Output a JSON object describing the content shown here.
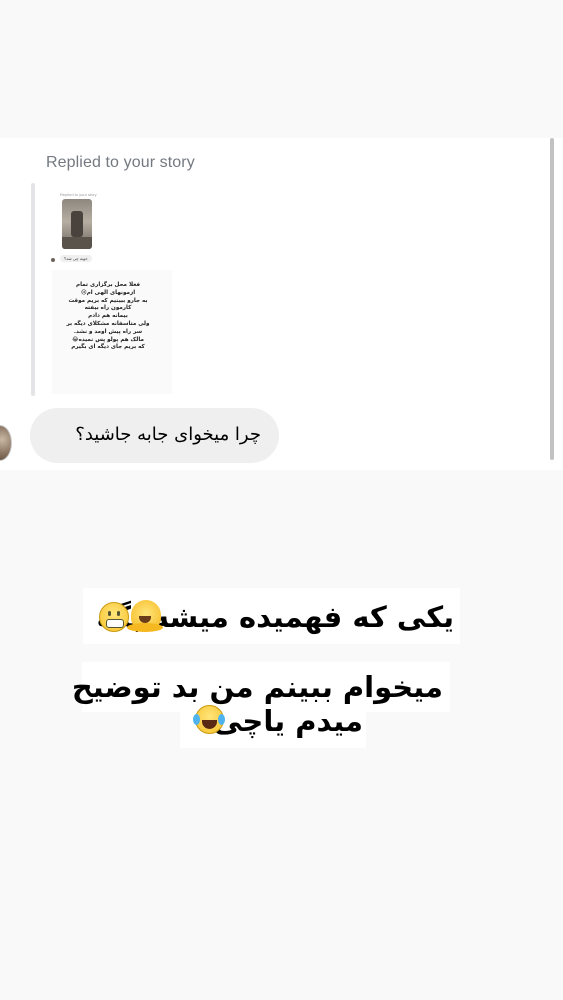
{
  "reply": {
    "label": "Replied to your story",
    "mini_label": "Replied to your story",
    "mini_message": "خونه چی شد؟",
    "story_lines": [
      "فعلا محل برگزاری تمام",
      "ازمونهای الهی ام😢",
      "به جارو ببینیم که بریم موقت",
      "کارمون راه بیفته",
      "بیمانه هم دادم",
      "ولی متاسفانه مشکلای دیگه بر",
      "سر راه پیش اومد و نشد.",
      "مالک هم پولو پس نمیده😂",
      "که بریم جای دیگه ای بگیرم"
    ]
  },
  "message": {
    "text": "چرا میخوای جابه جاشید؟"
  },
  "captions": {
    "line1": "یکی که فهمیده میشه بگه",
    "line2": "میخوام ببینم من بد توضیح",
    "line3": "میدم یاچی"
  },
  "icons": {
    "grimace": "grimacing-face-icon",
    "melting": "melting-face-icon",
    "crying": "tears-of-joy-face-icon"
  }
}
